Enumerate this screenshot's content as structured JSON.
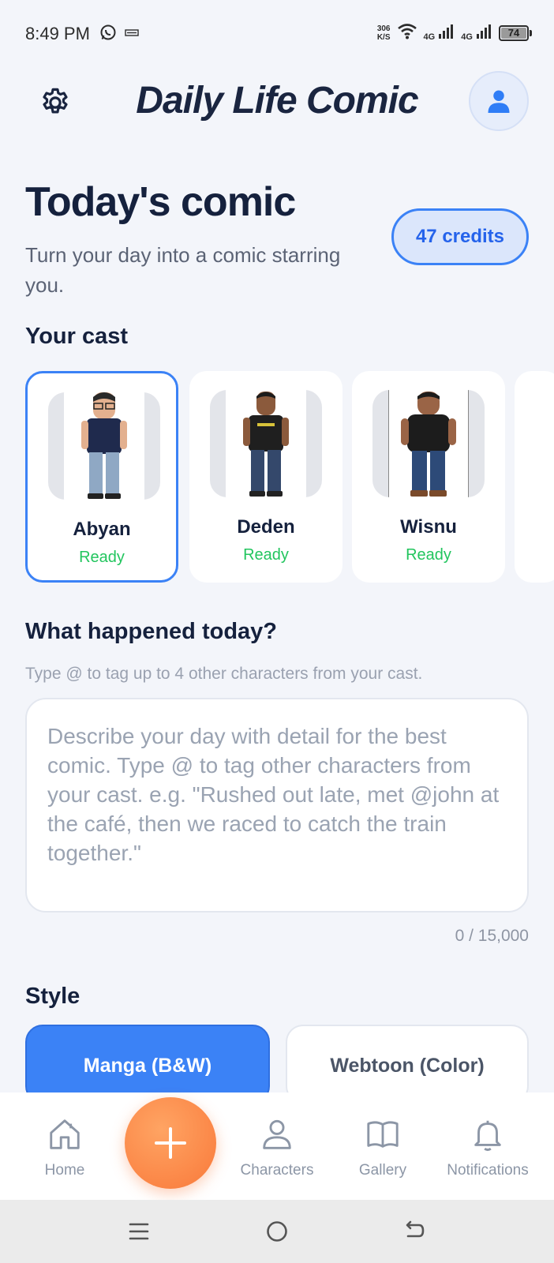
{
  "status_bar": {
    "time": "8:49 PM",
    "speed_value": "306",
    "speed_unit": "K/S",
    "network_1": "4G",
    "network_2": "4G",
    "battery": "74",
    "left_icons": [
      "whatsapp-icon",
      "bca-icon"
    ]
  },
  "header": {
    "title": "Daily Life Comic",
    "settings_icon": "gear-icon",
    "profile_icon": "user-icon"
  },
  "hero": {
    "title": "Today's comic",
    "subtitle": "Turn your day into a comic starring you.",
    "credits": "47 credits"
  },
  "cast": {
    "title": "Your cast",
    "items": [
      {
        "name": "Abyan",
        "status": "Ready",
        "selected": true
      },
      {
        "name": "Deden",
        "status": "Ready",
        "selected": false
      },
      {
        "name": "Wisnu",
        "status": "Ready",
        "selected": false
      }
    ]
  },
  "story": {
    "title": "What happened today?",
    "hint": "Type @ to tag up to 4 other characters from your cast.",
    "value": "",
    "placeholder": "Describe your day with detail for the best comic. Type @ to tag other characters from your cast. e.g. \"Rushed out late, met @john at the café, then we raced to catch the train together.\"",
    "counter": "0 / 15,000"
  },
  "style": {
    "title": "Style",
    "options": [
      {
        "label": "Manga (B&W)",
        "selected": true
      },
      {
        "label": "Webtoon (Color)",
        "selected": false
      }
    ]
  },
  "bottom_nav": {
    "items": [
      {
        "label": "Home",
        "icon": "home-icon"
      },
      {
        "label": "Characters",
        "icon": "user-icon"
      },
      {
        "label": "Gallery",
        "icon": "book-icon"
      },
      {
        "label": "Notifications",
        "icon": "bell-icon"
      }
    ],
    "fab_icon": "plus-icon"
  },
  "system_nav": [
    "menu-icon",
    "home-circle-icon",
    "back-icon"
  ],
  "colors": {
    "accent": "#3b82f6",
    "fab": "#f9793a",
    "ready": "#22c55e",
    "background": "#f3f5fa"
  }
}
